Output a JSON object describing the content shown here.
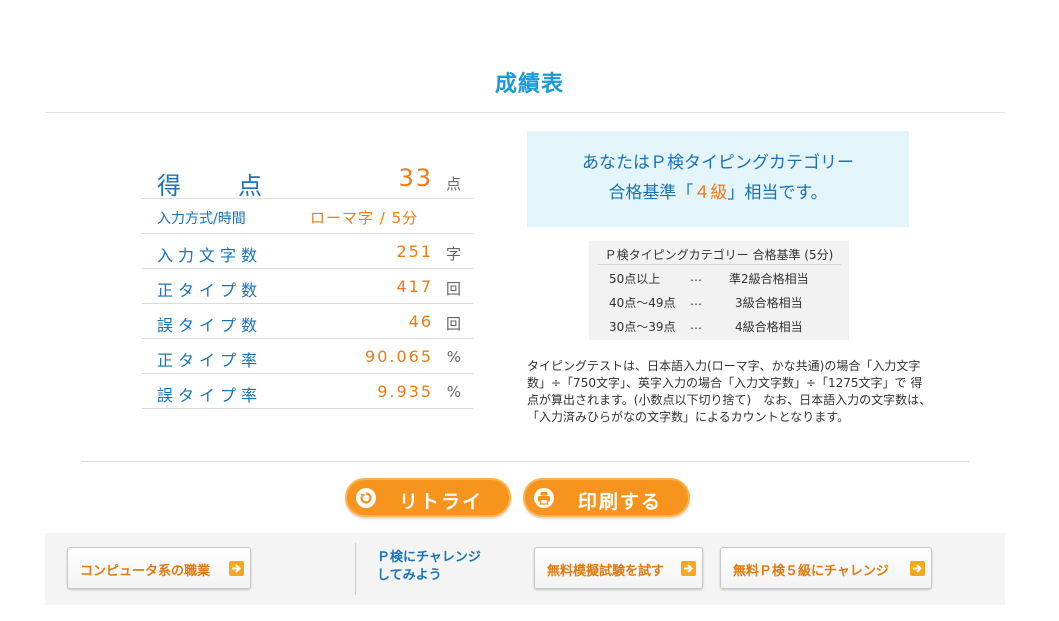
{
  "page": {
    "title": "成績表"
  },
  "score": {
    "label_chars": [
      "得",
      "点"
    ],
    "value": "33",
    "unit": "点"
  },
  "rows": [
    {
      "label": "入力方式/時間",
      "value": "ローマ字 / 5分",
      "unit": ""
    },
    {
      "label": "入力文字数",
      "value": "251",
      "unit": "字"
    },
    {
      "label": "正タイプ数",
      "value": "417",
      "unit": "回"
    },
    {
      "label": "誤タイプ数",
      "value": "46",
      "unit": "回"
    },
    {
      "label": "正タイプ率",
      "value": "90.065",
      "unit": "%"
    },
    {
      "label": "誤タイプ率",
      "value": "9.935",
      "unit": "%"
    }
  ],
  "result": {
    "line1": "あなたはＰ検タイピングカテゴリー",
    "line2_pre": "合格基準「",
    "grade": "４級",
    "line2_post": "」相当です。"
  },
  "criteria": {
    "header": "Ｐ検タイピングカテゴリー 合格基準 (5分)",
    "rows": [
      {
        "range": "50点以上",
        "dots": "…",
        "level": "準2級合格相当"
      },
      {
        "range": "40点～49点",
        "dots": "…",
        "level": "3級合格相当"
      },
      {
        "range": "30点～39点",
        "dots": "…",
        "level": "4級合格相当"
      }
    ]
  },
  "note": "タイピングテストは、日本語入力(ローマ字、かな共通)の場合「入力文字数」÷「750文字」、英字入力の場合「入力文字数」÷「1275文字」で 得点が算出されます。(小数点以下切り捨て)　なお、日本語入力の文字数は、「入力済みひらがなの文字数」によるカウントとなります。",
  "buttons": {
    "retry": "リトライ",
    "print": "印刷する"
  },
  "bottom": {
    "computer_jobs": "コンピュータ系の職業",
    "challenge_line1": "Ｐ検にチャレンジ",
    "challenge_line2": "してみよう",
    "mock_exam": "無料模擬試験を試す",
    "grade5": "無料Ｐ検５級にチャレンジ"
  },
  "colors": {
    "accent_blue": "#1a9ad6",
    "label_blue": "#1a73b8",
    "value_orange": "#f07a14",
    "button_orange": "#f7941d",
    "result_bg": "#e4f4fb"
  }
}
